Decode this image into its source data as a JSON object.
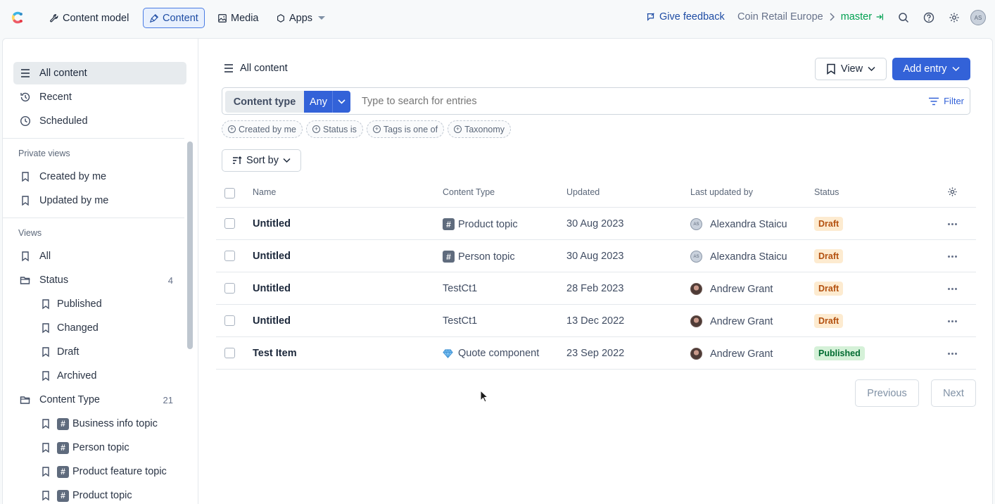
{
  "nav": {
    "content_model": "Content model",
    "content": "Content",
    "media": "Media",
    "apps": "Apps",
    "feedback": "Give feedback",
    "space": "Coin Retail Europe",
    "environment": "master",
    "user_initials": "AS"
  },
  "sidebar": {
    "top_items": [
      "All content",
      "Recent",
      "Scheduled"
    ],
    "private_views_label": "Private views",
    "private_views": [
      "Created by me",
      "Updated by me"
    ],
    "views_label": "Views",
    "view_all": "All",
    "status_folder": "Status",
    "status_count": "4",
    "status_items": [
      "Published",
      "Changed",
      "Draft",
      "Archived"
    ],
    "content_type_folder": "Content Type",
    "content_type_count": "21",
    "content_type_items": [
      "Business info topic",
      "Person topic",
      "Product feature topic",
      "Product topic"
    ],
    "hash_glyph": "#"
  },
  "main": {
    "title": "All content",
    "view_button": "View",
    "add_entry_button": "Add entry",
    "content_type_label": "Content type",
    "content_type_value": "Any",
    "search_placeholder": "Type to search for entries",
    "filter_button": "Filter",
    "chips": [
      "Created by me",
      "Status is",
      "Tags is one of",
      "Taxonomy"
    ],
    "sort_button": "Sort by"
  },
  "table": {
    "headers": [
      "Name",
      "Content Type",
      "Updated",
      "Last updated by",
      "Status"
    ],
    "rows": [
      {
        "name": "Untitled",
        "type": "Product topic",
        "type_icon": "hash",
        "updated": "30 Aug 2023",
        "user": "Alexandra Staicu",
        "user_initials": "AS",
        "status": "Draft"
      },
      {
        "name": "Untitled",
        "type": "Person topic",
        "type_icon": "hash",
        "updated": "30 Aug 2023",
        "user": "Alexandra Staicu",
        "user_initials": "AS",
        "status": "Draft"
      },
      {
        "name": "Untitled",
        "type": "TestCt1",
        "type_icon": "",
        "updated": "28 Feb 2023",
        "user": "Andrew Grant",
        "user_initials": "",
        "status": "Draft"
      },
      {
        "name": "Untitled",
        "type": "TestCt1",
        "type_icon": "",
        "updated": "13 Dec 2022",
        "user": "Andrew Grant",
        "user_initials": "",
        "status": "Draft"
      },
      {
        "name": "Test Item",
        "type": "Quote component",
        "type_icon": "diamond",
        "updated": "23 Sep 2022",
        "user": "Andrew Grant",
        "user_initials": "",
        "status": "Published"
      }
    ]
  },
  "pager": {
    "previous": "Previous",
    "next": "Next"
  },
  "colors": {
    "primary": "#3362d8",
    "draft_bg": "#fdebd0",
    "published_bg": "#d5f1d8"
  }
}
